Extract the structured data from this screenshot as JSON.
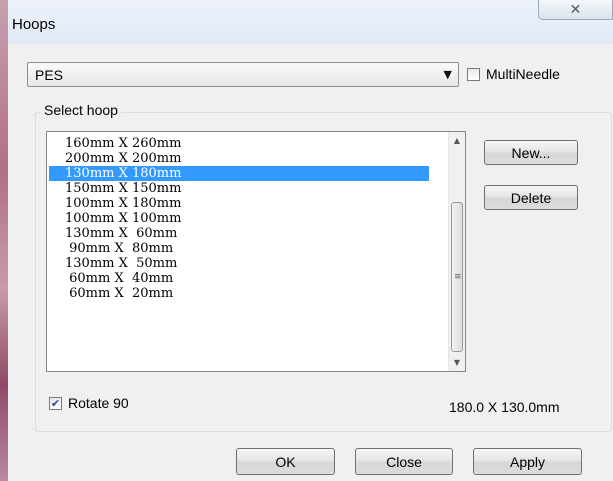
{
  "window": {
    "title": "Hoops",
    "close_glyph": "✕"
  },
  "format_select": {
    "value": "PES",
    "arrow": "▼"
  },
  "multineedle": {
    "label": "MultiNeedle",
    "checked": false
  },
  "hoop_group": {
    "title": "Select hoop",
    "selected_index": 2,
    "items": [
      "160mm X 260mm",
      "200mm X 200mm",
      "130mm X 180mm",
      "150mm X 150mm",
      "100mm X 180mm",
      "100mm X 100mm",
      "130mm X  60mm",
      " 90mm X  80mm",
      "130mm X  50mm",
      " 60mm X  40mm",
      " 60mm X  20mm"
    ],
    "scroll_up": "▲",
    "scroll_down": "▼",
    "grip": "≡"
  },
  "side_buttons": {
    "new_label": "New...",
    "delete_label": "Delete"
  },
  "rotate": {
    "label": "Rotate 90",
    "checked": true,
    "check_glyph": "✔"
  },
  "dimensions": "180.0 X 130.0mm",
  "footer": {
    "ok_label": "OK",
    "close_label": "Close",
    "apply_label": "Apply"
  }
}
